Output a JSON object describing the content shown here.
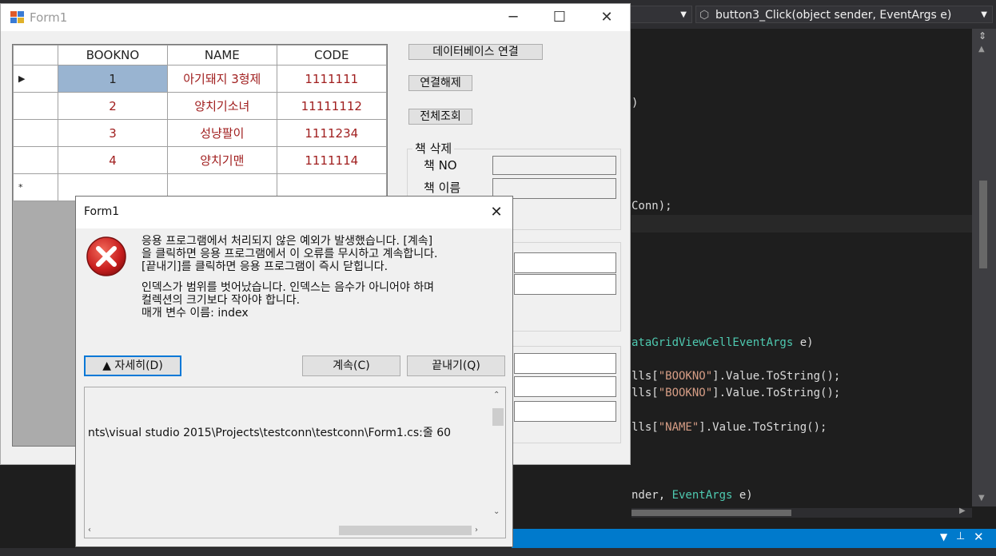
{
  "ide": {
    "method_dropdown": "button3_Click(object sender, EventArgs e)",
    "code_lines": [
      {
        "pre": ")",
        "str": "",
        "post": ""
      },
      {
        "pre": "Conn);",
        "str": "",
        "post": ""
      },
      {
        "type": "ataGridViewCellEventArgs",
        "post": " e)"
      },
      {
        "pre": "lls[",
        "str": "\"BOOKNO\"",
        "post": "].Value.ToString();"
      },
      {
        "pre": "lls[",
        "str": "\"BOOKNO\"",
        "post": "].Value.ToString();"
      },
      {
        "pre": "lls[",
        "str": "\"NAME\"",
        "post": "].Value.ToString();"
      },
      {
        "pre": "nder, ",
        "type": "EventArgs",
        "post": " e)"
      }
    ]
  },
  "form": {
    "title": "Form1",
    "grid": {
      "headers": [
        "BOOKNO",
        "NAME",
        "CODE"
      ],
      "rows": [
        {
          "marker": "▶",
          "bookno": "1",
          "name": "아기돼지 3형제",
          "code": "1111111"
        },
        {
          "marker": "",
          "bookno": "2",
          "name": "양치기소녀",
          "code": "11111112"
        },
        {
          "marker": "",
          "bookno": "3",
          "name": "성냥팔이",
          "code": "1111234"
        },
        {
          "marker": "",
          "bookno": "4",
          "name": "양치기맨",
          "code": "1111114"
        }
      ],
      "new_row_marker": "*"
    },
    "buttons": {
      "connect": "데이터베이스 연결",
      "disconnect": "연결해제",
      "view_all": "전체조회"
    },
    "delete_group": {
      "label": "책 삭제",
      "book_no_label": "책 NO",
      "book_name_label": "책 이름"
    }
  },
  "dialog": {
    "title": "Form1",
    "message1": "응용 프로그램에서 처리되지 않은 예외가 발생했습니다. [계속]\n을 클릭하면 응용 프로그램에서 이 오류를 무시하고 계속합니다.\n[끝내기]를 클릭하면 응용 프로그램이 즉시 닫힙니다.",
    "message2": "인덱스가 범위를 벗어났습니다. 인덱스는 음수가 아니어야 하며\n컬렉션의 크기보다 작아야 합니다.\n매개 변수 이름: index",
    "details_button": "▲ 자세히(D)",
    "continue_button": "계속(C)",
    "quit_button": "끝내기(Q)",
    "details_text": "nts\\visual studio 2015\\Projects\\testconn\\testconn\\Form1.cs:줄 60"
  }
}
